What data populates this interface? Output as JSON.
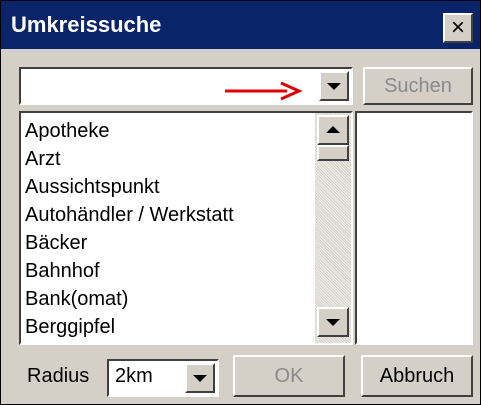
{
  "window": {
    "title": "Umkreissuche",
    "close_label": "×"
  },
  "search": {
    "category_value": "",
    "search_button": "Suchen"
  },
  "list": {
    "items": [
      "Apotheke",
      "Arzt",
      "Aussichtspunkt",
      "Autohändler / Werkstatt",
      "Bäcker",
      "Bahnhof",
      "Bank(omat)",
      "Berggipfel"
    ]
  },
  "footer": {
    "radius_label": "Radius",
    "radius_value": "2km",
    "ok_button": "OK",
    "cancel_button": "Abbruch"
  },
  "colors": {
    "titlebar": "#0a246a",
    "face": "#d4d0c8",
    "annotation_arrow": "#e00000",
    "disabled_text": "#8a8a8a"
  }
}
